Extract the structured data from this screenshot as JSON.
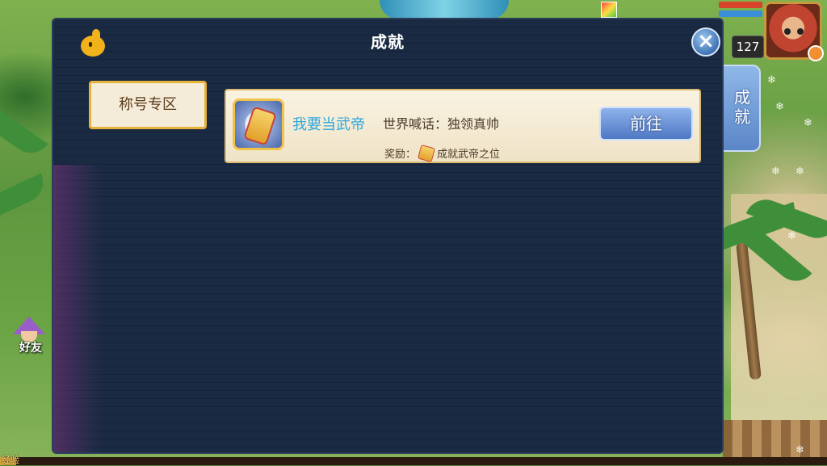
{
  "window": {
    "title": "成就"
  },
  "categories": [
    {
      "label": "称号专区",
      "selected": true
    }
  ],
  "achievements": [
    {
      "name": "我要当武帝",
      "description": "世界喊话：独领真帅",
      "reward_label": "奖励：",
      "reward_item": "成就武帝之位",
      "action_label": "前往"
    }
  ],
  "side_tab": {
    "label": "成就"
  },
  "hud": {
    "level": "127"
  },
  "friend": {
    "label": "好友"
  },
  "exp": {
    "label": "经验",
    "fraction": 0.02
  },
  "colors": {
    "panel_bg": "#1a2a43",
    "title_text": "#ffffff",
    "achievement_name": "#2ea7e0",
    "button_blue": "#4f79c5",
    "category_border": "#e7b23a",
    "row_bg": "#faf3e2"
  },
  "icons": {
    "close": "close-icon",
    "mascot": "mascot-chick-icon",
    "achievement": "scroll-item-icon",
    "reward": "scroll-small-icon",
    "friend": "friend-hat-icon"
  }
}
